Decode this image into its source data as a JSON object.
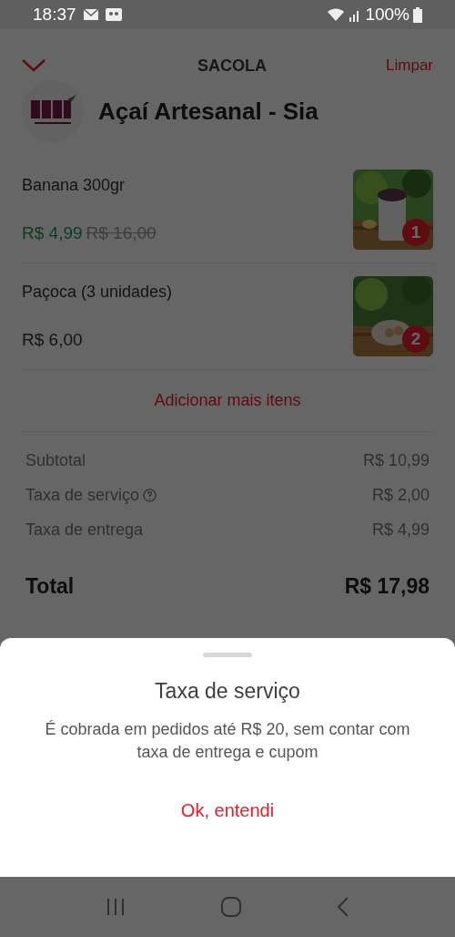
{
  "status_bar": {
    "time": "18:37",
    "battery": "100%"
  },
  "header": {
    "title": "SACOLA",
    "action": "Limpar"
  },
  "store": {
    "name": "Açaí Artesanal - Sia"
  },
  "items": [
    {
      "name": "Banana 300gr",
      "price": "R$ 4,99",
      "old_price": "R$ 16,00",
      "quantity": "1",
      "on_sale": true
    },
    {
      "name": "Paçoca (3 unidades)",
      "price": "R$ 6,00",
      "quantity": "2",
      "on_sale": false
    }
  ],
  "add_more": "Adicionar mais itens",
  "summary": [
    {
      "label": "Subtotal",
      "value": "R$ 10,99",
      "info": false
    },
    {
      "label": "Taxa de serviço",
      "value": "R$ 2,00",
      "info": true
    },
    {
      "label": "Taxa de entrega",
      "value": "R$ 4,99",
      "info": false
    }
  ],
  "total": {
    "label": "Total",
    "value": "R$ 17,98"
  },
  "sheet": {
    "title": "Taxa de serviço",
    "message": "É cobrada em pedidos até R$ 20, sem contar com taxa de entrega e cupom",
    "button": "Ok, entendi"
  }
}
